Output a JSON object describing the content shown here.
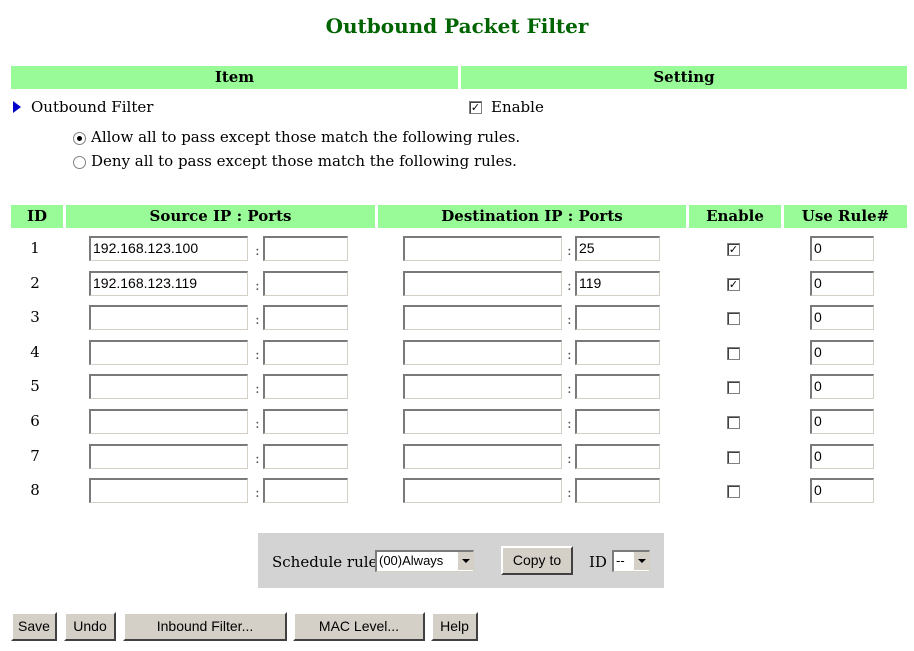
{
  "title": "Outbound Packet Filter",
  "top_header": {
    "item": "Item",
    "setting": "Setting"
  },
  "outbound_filter": {
    "label": "Outbound Filter",
    "enable_label": "Enable",
    "enabled": true,
    "allow_label": "Allow all to pass except those match the following rules.",
    "deny_label": "Deny all to pass except those match the following rules.",
    "mode": "allow"
  },
  "table_header": {
    "id": "ID",
    "source": "Source IP : Ports",
    "destination": "Destination IP : Ports",
    "enable": "Enable",
    "use_rule": "Use Rule#"
  },
  "separator": ":",
  "rules": [
    {
      "id": "1",
      "src_ip": "192.168.123.100",
      "src_port": "",
      "dst_ip": "",
      "dst_port": "25",
      "enabled": true,
      "use_rule": "0"
    },
    {
      "id": "2",
      "src_ip": "192.168.123.119",
      "src_port": "",
      "dst_ip": "",
      "dst_port": "119",
      "enabled": true,
      "use_rule": "0"
    },
    {
      "id": "3",
      "src_ip": "",
      "src_port": "",
      "dst_ip": "",
      "dst_port": "",
      "enabled": false,
      "use_rule": "0"
    },
    {
      "id": "4",
      "src_ip": "",
      "src_port": "",
      "dst_ip": "",
      "dst_port": "",
      "enabled": false,
      "use_rule": "0"
    },
    {
      "id": "5",
      "src_ip": "",
      "src_port": "",
      "dst_ip": "",
      "dst_port": "",
      "enabled": false,
      "use_rule": "0"
    },
    {
      "id": "6",
      "src_ip": "",
      "src_port": "",
      "dst_ip": "",
      "dst_port": "",
      "enabled": false,
      "use_rule": "0"
    },
    {
      "id": "7",
      "src_ip": "",
      "src_port": "",
      "dst_ip": "",
      "dst_port": "",
      "enabled": false,
      "use_rule": "0"
    },
    {
      "id": "8",
      "src_ip": "",
      "src_port": "",
      "dst_ip": "",
      "dst_port": "",
      "enabled": false,
      "use_rule": "0"
    }
  ],
  "schedule": {
    "label": "Schedule rule",
    "selected": "(00)Always",
    "copy_button": "Copy to",
    "id_label": "ID",
    "id_selected": "--"
  },
  "buttons": {
    "save": "Save",
    "undo": "Undo",
    "inbound": "Inbound Filter...",
    "mac": "MAC Level...",
    "help": "Help"
  },
  "colors": {
    "title": "#006400",
    "header_bg": "#98FB98",
    "schedule_bg": "#d3d3d3",
    "arrow": "#0000cc"
  }
}
